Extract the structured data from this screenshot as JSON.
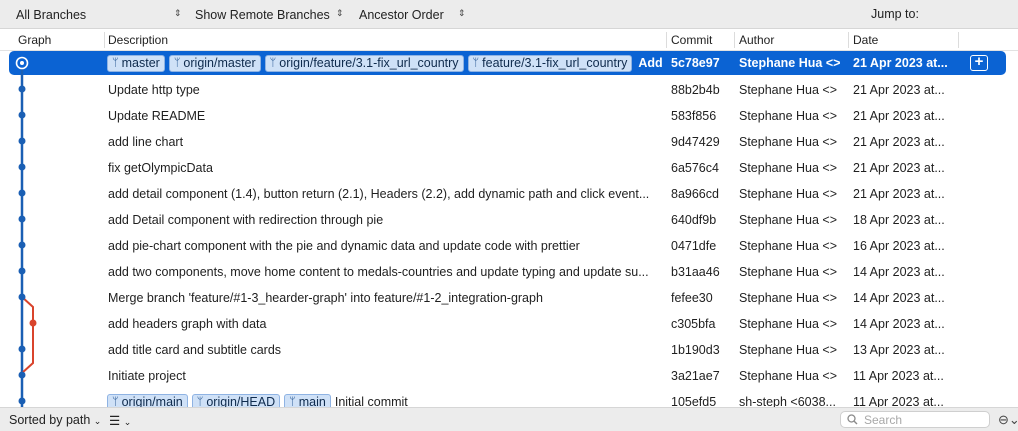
{
  "toolbar": {
    "branches": "All Branches",
    "remote": "Show Remote Branches",
    "order": "Ancestor Order",
    "jump": "Jump to:"
  },
  "columns": {
    "graph": "Graph",
    "description": "Description",
    "commit": "Commit",
    "author": "Author",
    "date": "Date"
  },
  "rows": [
    {
      "tags": [
        "master",
        "origin/master",
        "origin/feature/3.1-fix_url_country",
        "feature/3.1-fix_url_country"
      ],
      "description": "Add...",
      "commit": "5c78e97",
      "author": "Stephane Hua <>",
      "date": "21 Apr 2023 at..."
    },
    {
      "tags": [],
      "description": "Update http type",
      "commit": "88b2b4b",
      "author": "Stephane Hua <>",
      "date": "21 Apr 2023 at..."
    },
    {
      "tags": [],
      "description": "Update README",
      "commit": "583f856",
      "author": "Stephane Hua <>",
      "date": "21 Apr 2023 at..."
    },
    {
      "tags": [],
      "description": "add line chart",
      "commit": "9d47429",
      "author": "Stephane Hua <>",
      "date": "21 Apr 2023 at..."
    },
    {
      "tags": [],
      "description": "fix getOlympicData",
      "commit": "6a576c4",
      "author": "Stephane Hua <>",
      "date": "21 Apr 2023 at..."
    },
    {
      "tags": [],
      "description": "add detail component (1.4), button return (2.1), Headers (2.2), add dynamic path and click event...",
      "commit": "8a966cd",
      "author": "Stephane Hua <>",
      "date": "21 Apr 2023 at..."
    },
    {
      "tags": [],
      "description": "add Detail component with redirection through pie",
      "commit": "640df9b",
      "author": "Stephane Hua <>",
      "date": "18 Apr 2023 at..."
    },
    {
      "tags": [],
      "description": "add pie-chart component with the pie and dynamic data and update code with prettier",
      "commit": "0471dfe",
      "author": "Stephane Hua <>",
      "date": "16 Apr 2023 at..."
    },
    {
      "tags": [],
      "description": "add two components, move home content to medals-countries and update typing and update su...",
      "commit": "b31aa46",
      "author": "Stephane Hua <>",
      "date": "14 Apr 2023 at..."
    },
    {
      "tags": [],
      "description": "Merge branch 'feature/#1-3_hearder-graph' into feature/#1-2_integration-graph",
      "commit": "fefee30",
      "author": "Stephane Hua <>",
      "date": "14 Apr 2023 at..."
    },
    {
      "tags": [],
      "description": "add headers graph with data",
      "commit": "c305bfa",
      "author": "Stephane Hua <>",
      "date": "14 Apr 2023 at..."
    },
    {
      "tags": [],
      "description": "add title card and subtitle cards",
      "commit": "1b190d3",
      "author": "Stephane Hua <>",
      "date": "13 Apr 2023 at..."
    },
    {
      "tags": [],
      "description": "Initiate project",
      "commit": "3a21ae7",
      "author": "Stephane Hua <>",
      "date": "11 Apr 2023 at..."
    },
    {
      "tags": [
        "origin/main",
        "origin/HEAD",
        "main"
      ],
      "description": "Initial commit",
      "commit": "105efd5",
      "author": "sh-steph <6038...",
      "date": "11 Apr 2023 at..."
    }
  ],
  "footer": {
    "sort": "Sorted by path",
    "search_placeholder": "Search"
  },
  "colors": {
    "selection": "#0b63d3",
    "graph_main": "#1a5fb4",
    "graph_branch": "#d9442c",
    "tag_bg": "#cfe1f7"
  },
  "icons": [
    "updown-icon",
    "branch-icon",
    "plus-icon",
    "list-icon",
    "chevron-down-icon",
    "search-icon",
    "more-icon"
  ]
}
